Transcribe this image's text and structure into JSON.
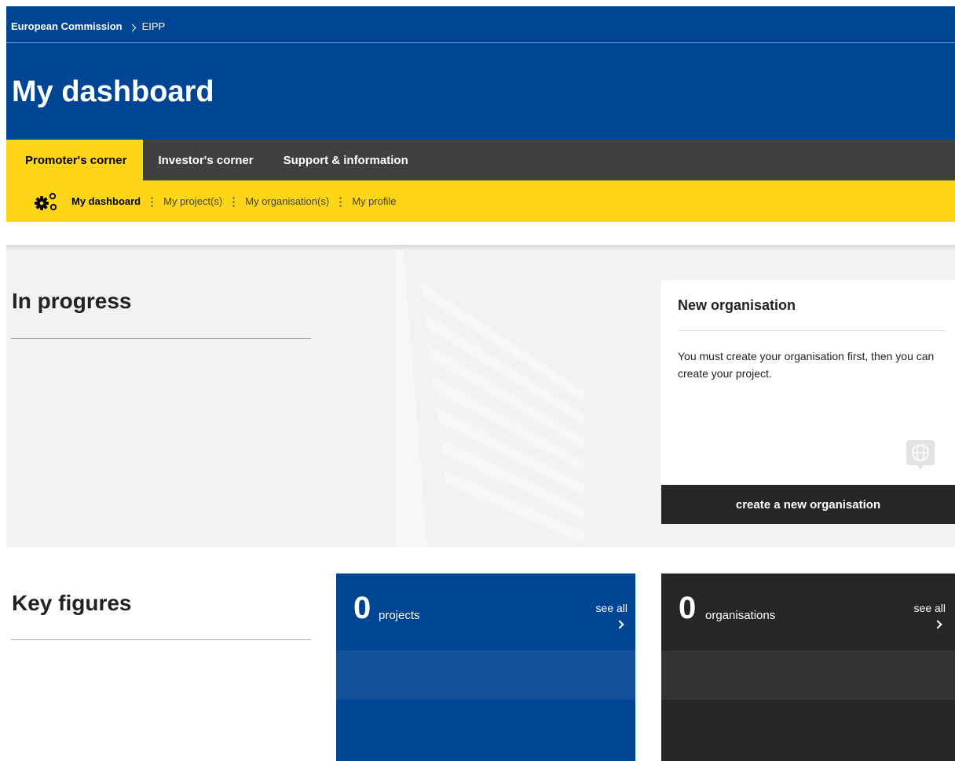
{
  "header": {
    "breadcrumb": [
      "European Commission",
      "EIPP"
    ],
    "title": "My dashboard"
  },
  "main_nav": {
    "tabs": [
      {
        "label": "Promoter's corner",
        "active": true
      },
      {
        "label": "Investor's corner",
        "active": false
      },
      {
        "label": "Support & information",
        "active": false
      }
    ]
  },
  "sub_nav": {
    "icon": "gears-icon",
    "items": [
      {
        "label": "My dashboard",
        "active": true
      },
      {
        "label": "My project(s)",
        "active": false
      },
      {
        "label": "My organisation(s)",
        "active": false
      },
      {
        "label": "My profile",
        "active": false
      }
    ]
  },
  "in_progress": {
    "title": "In progress"
  },
  "new_org_card": {
    "title": "New organisation",
    "text": "You must create your organisation first, then you can create your project.",
    "icon": "chat-globe-icon",
    "button": "create a new organisation"
  },
  "key_figures": {
    "title": "Key figures",
    "items": [
      {
        "value": "0",
        "label": "projects",
        "link": "see all",
        "color": "#004494"
      },
      {
        "value": "0",
        "label": "organisations",
        "link": "see all",
        "color": "#262626"
      }
    ]
  },
  "colors": {
    "brand_blue": "#004494",
    "accent_yellow": "#ffd617",
    "nav_dark": "#404040"
  }
}
